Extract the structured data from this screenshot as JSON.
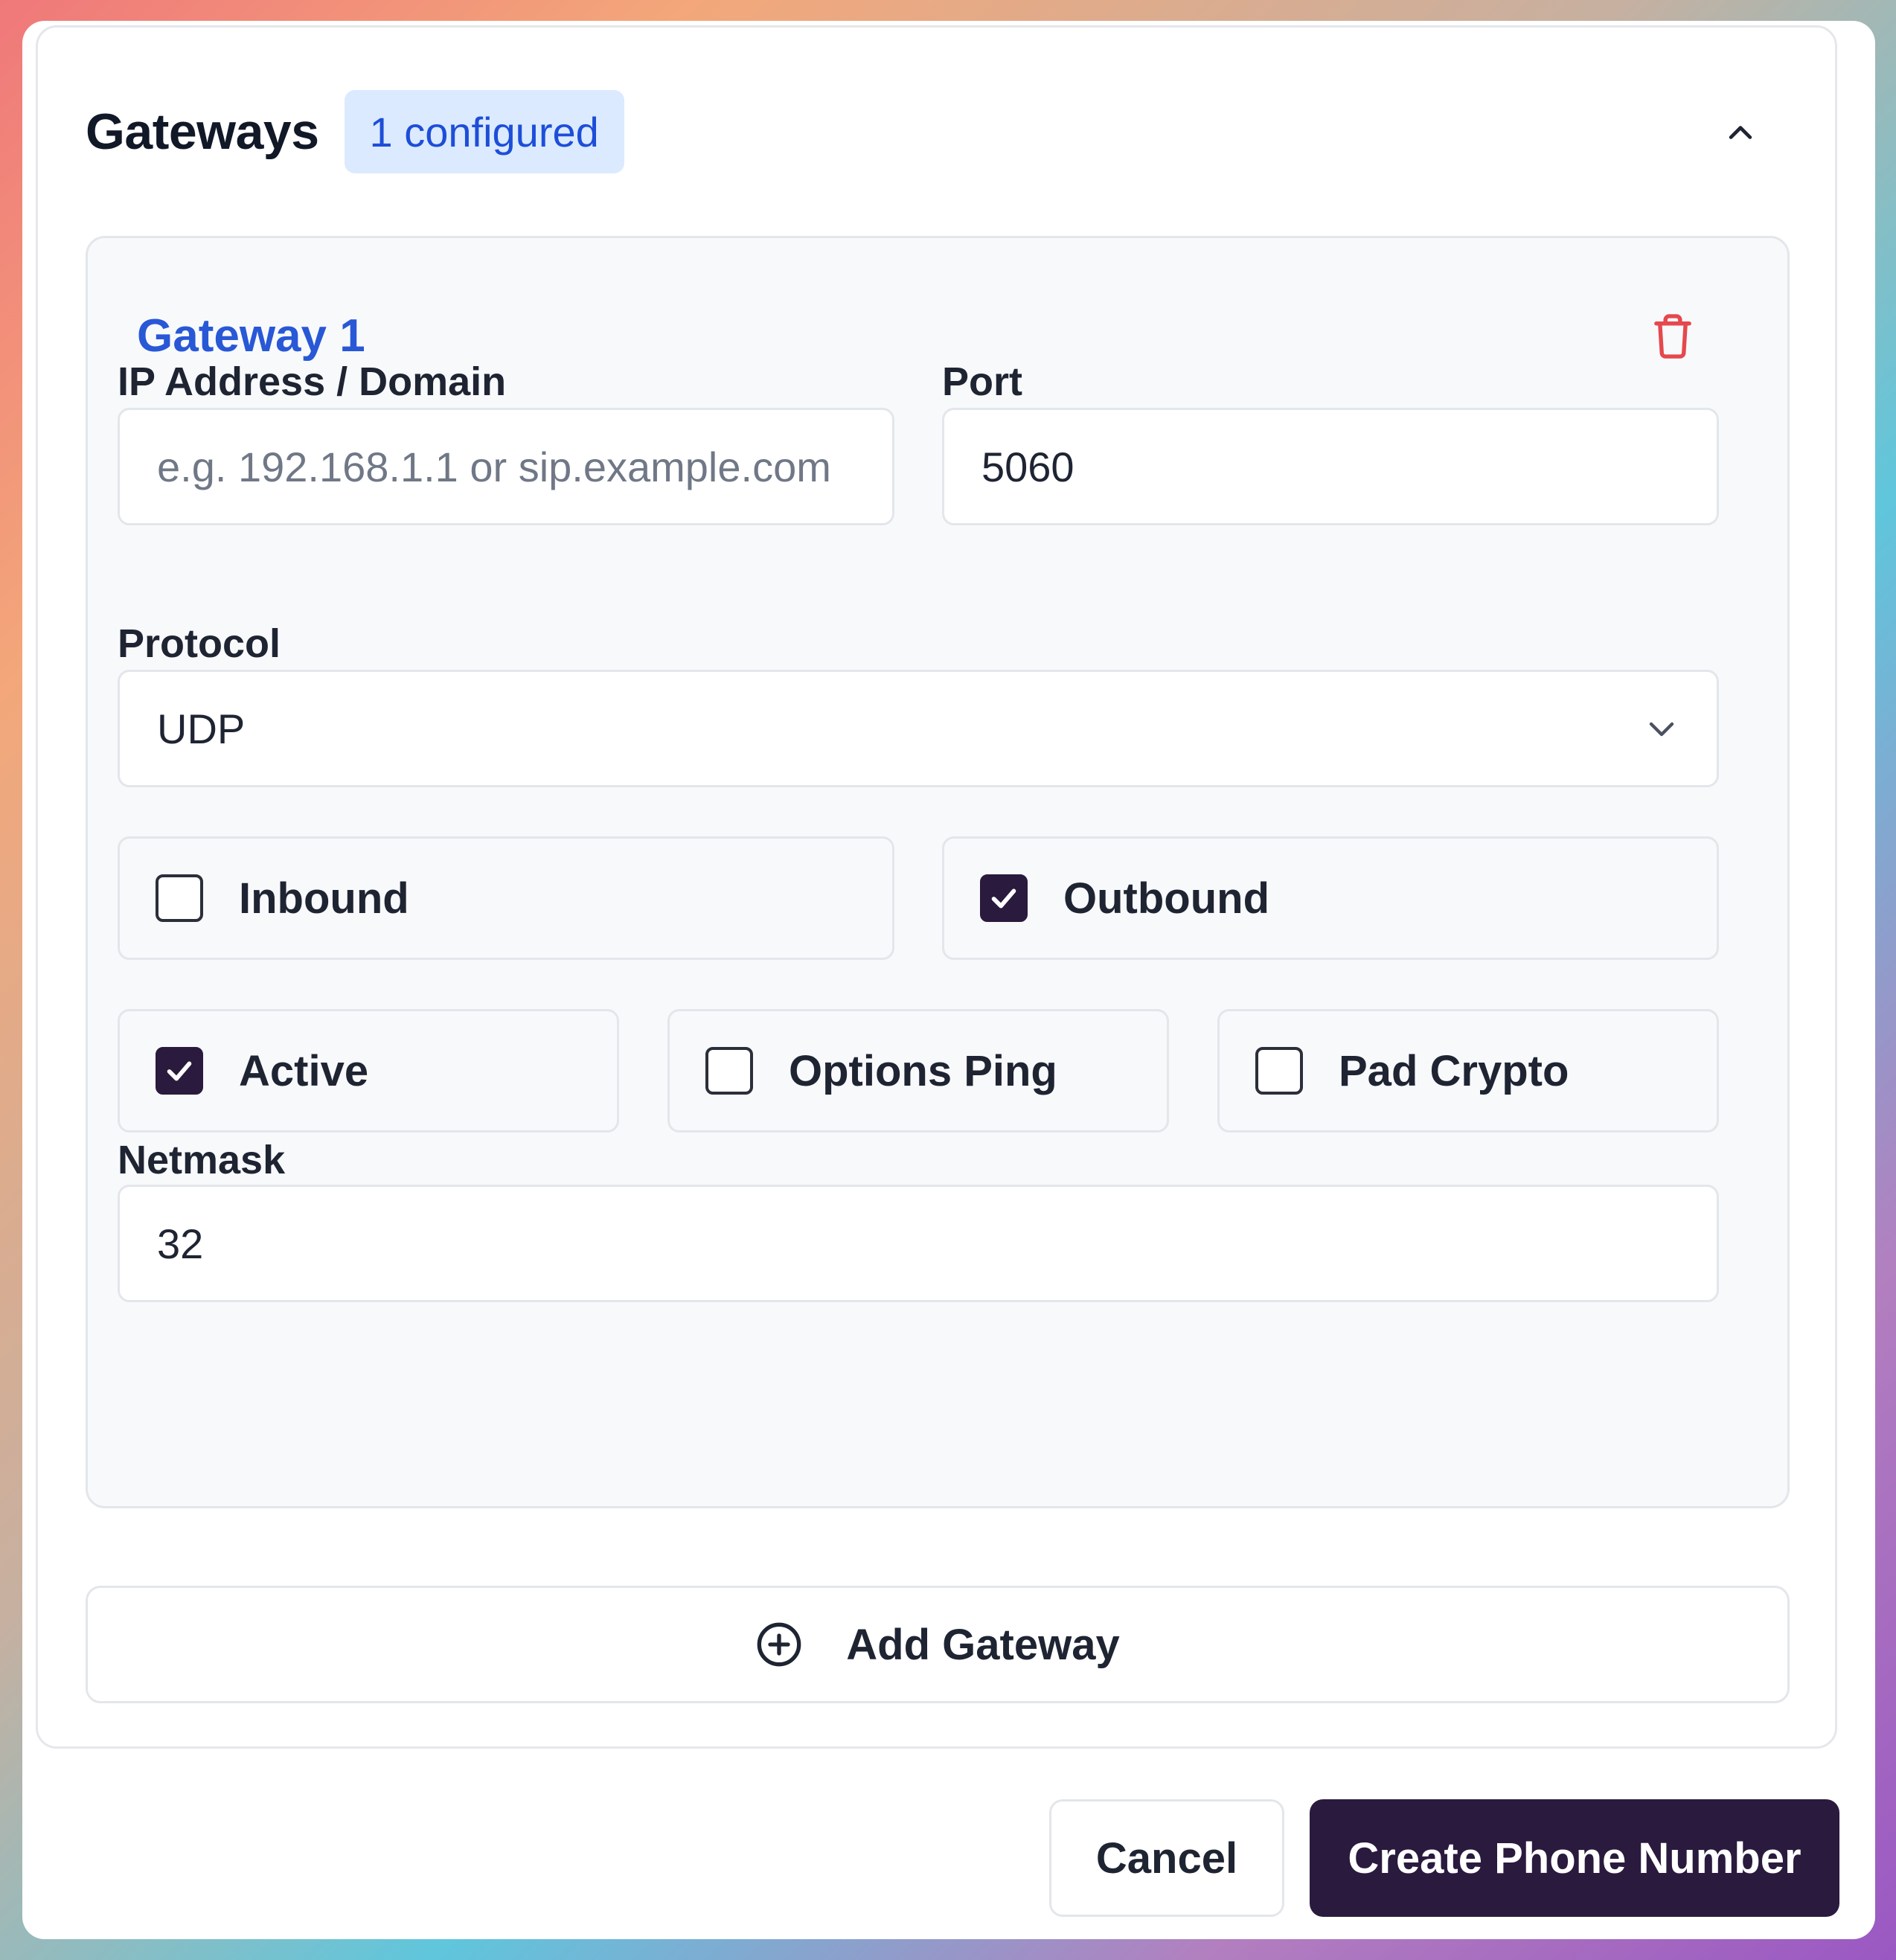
{
  "gateways": {
    "title": "Gateways",
    "badge": "1 configured",
    "collapse_icon": "chevron-up-icon"
  },
  "gateway": {
    "title": "Gateway 1",
    "delete_icon": "trash-icon",
    "delete_color": "#e5484d",
    "ip_label": "IP Address / Domain",
    "ip_placeholder": "e.g. 192.168.1.1 or sip.example.com",
    "ip_value": "",
    "port_label": "Port",
    "port_value": "5060",
    "protocol_label": "Protocol",
    "protocol_value": "UDP",
    "inbound_label": "Inbound",
    "inbound_checked": false,
    "outbound_label": "Outbound",
    "outbound_checked": true,
    "active_label": "Active",
    "active_checked": true,
    "options_ping_label": "Options Ping",
    "options_ping_checked": false,
    "pad_crypto_label": "Pad Crypto",
    "pad_crypto_checked": false,
    "netmask_label": "Netmask",
    "netmask_value": "32"
  },
  "add_gateway_label": "Add Gateway",
  "footer": {
    "cancel_label": "Cancel",
    "create_label": "Create Phone Number"
  },
  "colors": {
    "accent": "#2858d6",
    "primary_button": "#2a1a3e",
    "badge_bg": "#dbeafe"
  }
}
